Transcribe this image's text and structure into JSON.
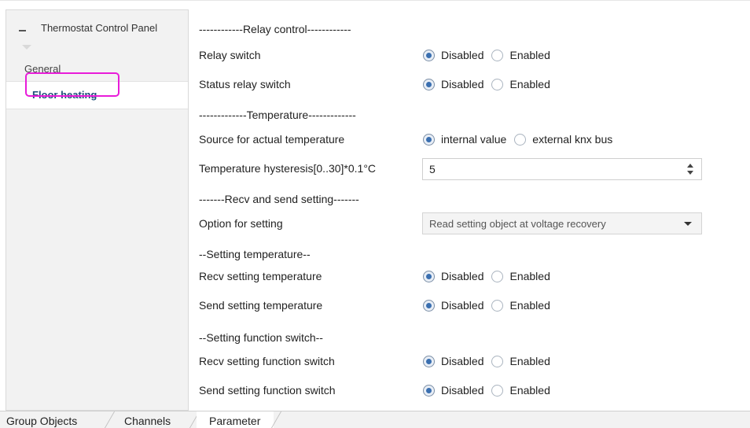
{
  "tree": {
    "root_label": "Thermostat Control Panel",
    "items": [
      {
        "label": "General"
      },
      {
        "label": "Floor heating"
      }
    ]
  },
  "params": {
    "sep_relay": "------------Relay control------------",
    "relay_switch": {
      "label": "Relay switch",
      "opt1": "Disabled",
      "opt2": "Enabled",
      "selected": "Disabled"
    },
    "status_relay_switch": {
      "label": "Status relay switch",
      "opt1": "Disabled",
      "opt2": "Enabled",
      "selected": "Disabled"
    },
    "sep_temperature": "-------------Temperature-------------",
    "source_temp": {
      "label": "Source for actual temperature",
      "opt1": "internal value",
      "opt2": "external knx bus",
      "selected": "internal value"
    },
    "hysteresis": {
      "label": "Temperature hysteresis[0..30]*0.1°C",
      "value": "5"
    },
    "sep_recv_send": "-------Recv and send setting-------",
    "option_setting": {
      "label": "Option for setting",
      "value": "Read setting object at voltage recovery"
    },
    "sep_setting_temp": "--Setting temperature--",
    "recv_setting_temp": {
      "label": "Recv setting temperature",
      "opt1": "Disabled",
      "opt2": "Enabled",
      "selected": "Disabled"
    },
    "send_setting_temp": {
      "label": "Send setting temperature",
      "opt1": "Disabled",
      "opt2": "Enabled",
      "selected": "Disabled"
    },
    "sep_setting_func": "--Setting function switch--",
    "recv_setting_func": {
      "label": "Recv setting function switch",
      "opt1": "Disabled",
      "opt2": "Enabled",
      "selected": "Disabled"
    },
    "send_setting_func": {
      "label": "Send setting function switch",
      "opt1": "Disabled",
      "opt2": "Enabled",
      "selected": "Disabled"
    }
  },
  "tabs": [
    {
      "label": "Group Objects"
    },
    {
      "label": "Channels"
    },
    {
      "label": "Parameter"
    }
  ],
  "colors": {
    "highlight": "#e81cd9",
    "radio_selected": "#3a6fb0",
    "selected_item_text": "#1d4f7a"
  }
}
